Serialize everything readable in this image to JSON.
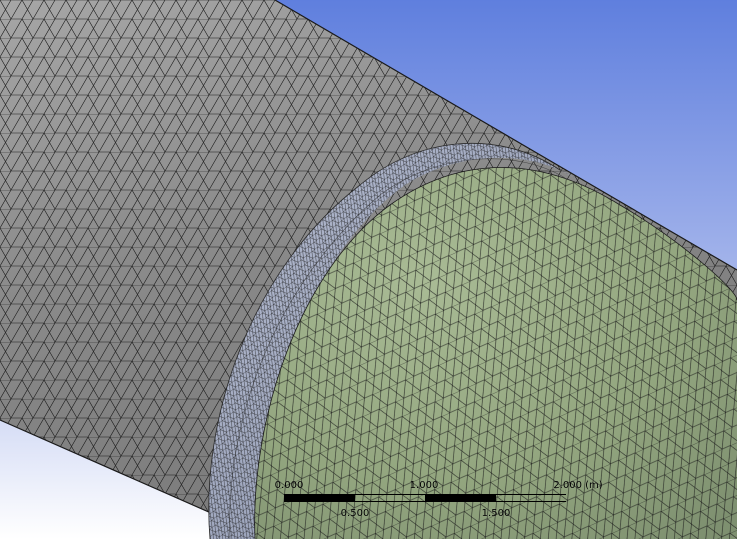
{
  "viewport": {
    "background_top": "#5f7fde",
    "background_bottom": "#ffffff",
    "pipe_color": "#8c8c8c",
    "cap_color": "#96a882",
    "ring_color": "#9ea6bd",
    "mesh_color": "#1a1a1a"
  },
  "scale_bar": {
    "unit": "(m)",
    "top_labels": [
      "0.000",
      "1.000",
      "2.000 (m)"
    ],
    "bottom_labels": [
      "0.500",
      "1.500"
    ]
  }
}
